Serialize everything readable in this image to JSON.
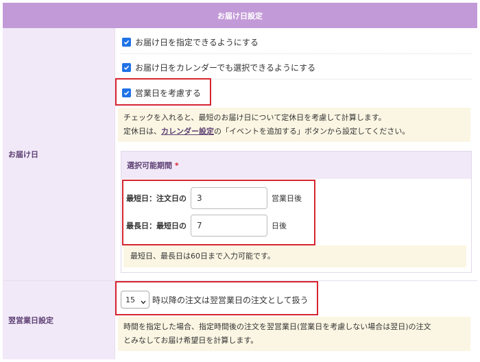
{
  "header": {
    "title": "お届け日設定"
  },
  "delivery_section": {
    "label": "お届け日",
    "options": [
      {
        "label": "お届け日を指定できるようにする",
        "checked": true
      },
      {
        "label": "お届け日をカレンダーでも選択できるようにする",
        "checked": true
      },
      {
        "label": "営業日を考慮する",
        "checked": true
      }
    ],
    "note_line1": "チェックを入れると、最短のお届け日について定休日を考慮して計算します。",
    "note_line2_pre": "定休日は、",
    "note_link": "カレンダー設定",
    "note_line2_post": "の「イベントを追加する」ボタンから設定してください。",
    "period": {
      "title": "選択可能期間",
      "required_mark": "*",
      "min_label": "最短日：注文日の",
      "min_value": "3",
      "min_unit": "営業日後",
      "max_label": "最長日：最短日の",
      "max_value": "7",
      "max_unit": "日後",
      "hint": "最短日、最長日は60日まで入力可能です。"
    }
  },
  "next_business_day_section": {
    "label": "翌営業日設定",
    "hour_select": "15",
    "hour_text": "時以降の注文は翌営業日の注文として扱う",
    "note_line1": "時間を指定した場合、指定時間後の注文を翌営業日(営業日を考慮しない場合は翌日)の注文",
    "note_line2": "とみなしてお届け希望日を計算します。"
  },
  "colors": {
    "header": "#c39ad8",
    "accent_red": "#d6242f",
    "checkbox": "#1f73e6"
  }
}
